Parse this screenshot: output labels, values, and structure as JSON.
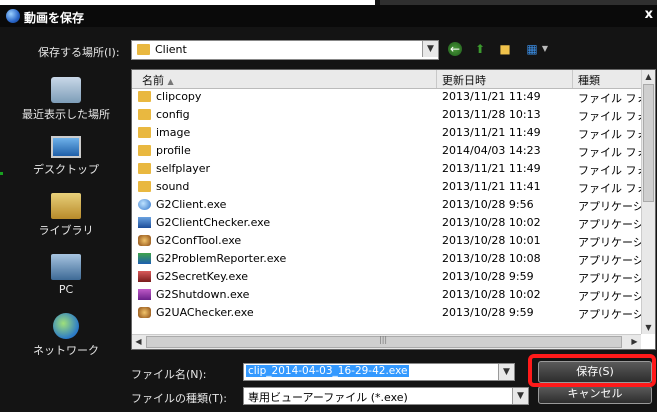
{
  "dialog": {
    "title": "動画を保存",
    "close": "x"
  },
  "save_in": {
    "label": "保存する場所(I):",
    "value": "Client"
  },
  "places": [
    {
      "label": "最近表示した場所",
      "icon": "recent-places-icon"
    },
    {
      "label": "デスクトップ",
      "icon": "desktop-icon"
    },
    {
      "label": "ライブラリ",
      "icon": "libraries-icon"
    },
    {
      "label": "PC",
      "icon": "computer-icon"
    },
    {
      "label": "ネットワーク",
      "icon": "network-icon"
    }
  ],
  "columns": {
    "name": "名前",
    "date": "更新日時",
    "type": "種類"
  },
  "files": [
    {
      "name": "clipcopy",
      "date": "2013/11/21 11:49",
      "type": "ファイル フォル",
      "icon": "folder-icon"
    },
    {
      "name": "config",
      "date": "2013/11/28 10:13",
      "type": "ファイル フォル",
      "icon": "folder-icon"
    },
    {
      "name": "image",
      "date": "2013/11/21 11:49",
      "type": "ファイル フォル",
      "icon": "folder-icon"
    },
    {
      "name": "profile",
      "date": "2014/04/03 14:23",
      "type": "ファイル フォル",
      "icon": "folder-icon"
    },
    {
      "name": "selfplayer",
      "date": "2013/11/21 11:49",
      "type": "ファイル フォル",
      "icon": "folder-icon"
    },
    {
      "name": "sound",
      "date": "2013/11/21 11:41",
      "type": "ファイル フォル",
      "icon": "folder-icon"
    },
    {
      "name": "G2Client.exe",
      "date": "2013/10/28 9:56",
      "type": "アプリケーショ",
      "icon": "globe-icon"
    },
    {
      "name": "G2ClientChecker.exe",
      "date": "2013/10/28 10:02",
      "type": "アプリケーショ",
      "icon": "checker-icon"
    },
    {
      "name": "G2ConfTool.exe",
      "date": "2013/10/28 10:01",
      "type": "アプリケーショ",
      "icon": "gear-icon"
    },
    {
      "name": "G2ProblemReporter.exe",
      "date": "2013/10/28 10:08",
      "type": "アプリケーショ",
      "icon": "reporter-icon"
    },
    {
      "name": "G2SecretKey.exe",
      "date": "2013/10/28 9:59",
      "type": "アプリケーショ",
      "icon": "key-icon"
    },
    {
      "name": "G2Shutdown.exe",
      "date": "2013/10/28 10:02",
      "type": "アプリケーショ",
      "icon": "shutdown-icon"
    },
    {
      "name": "G2UAChecker.exe",
      "date": "2013/10/28 9:59",
      "type": "アプリケーショ",
      "icon": "gear-icon"
    }
  ],
  "filename": {
    "label": "ファイル名(N):",
    "value": "clip_2014-04-03_16-29-42.exe"
  },
  "filetype": {
    "label": "ファイルの種類(T):",
    "value": "専用ビューアーファイル (*.exe)"
  },
  "buttons": {
    "save": "保存(S)",
    "cancel": "キャンセル"
  },
  "colors": {
    "dialog_bg": "#141414",
    "selection": "#3399ff",
    "highlight": "#ff1a1a"
  }
}
